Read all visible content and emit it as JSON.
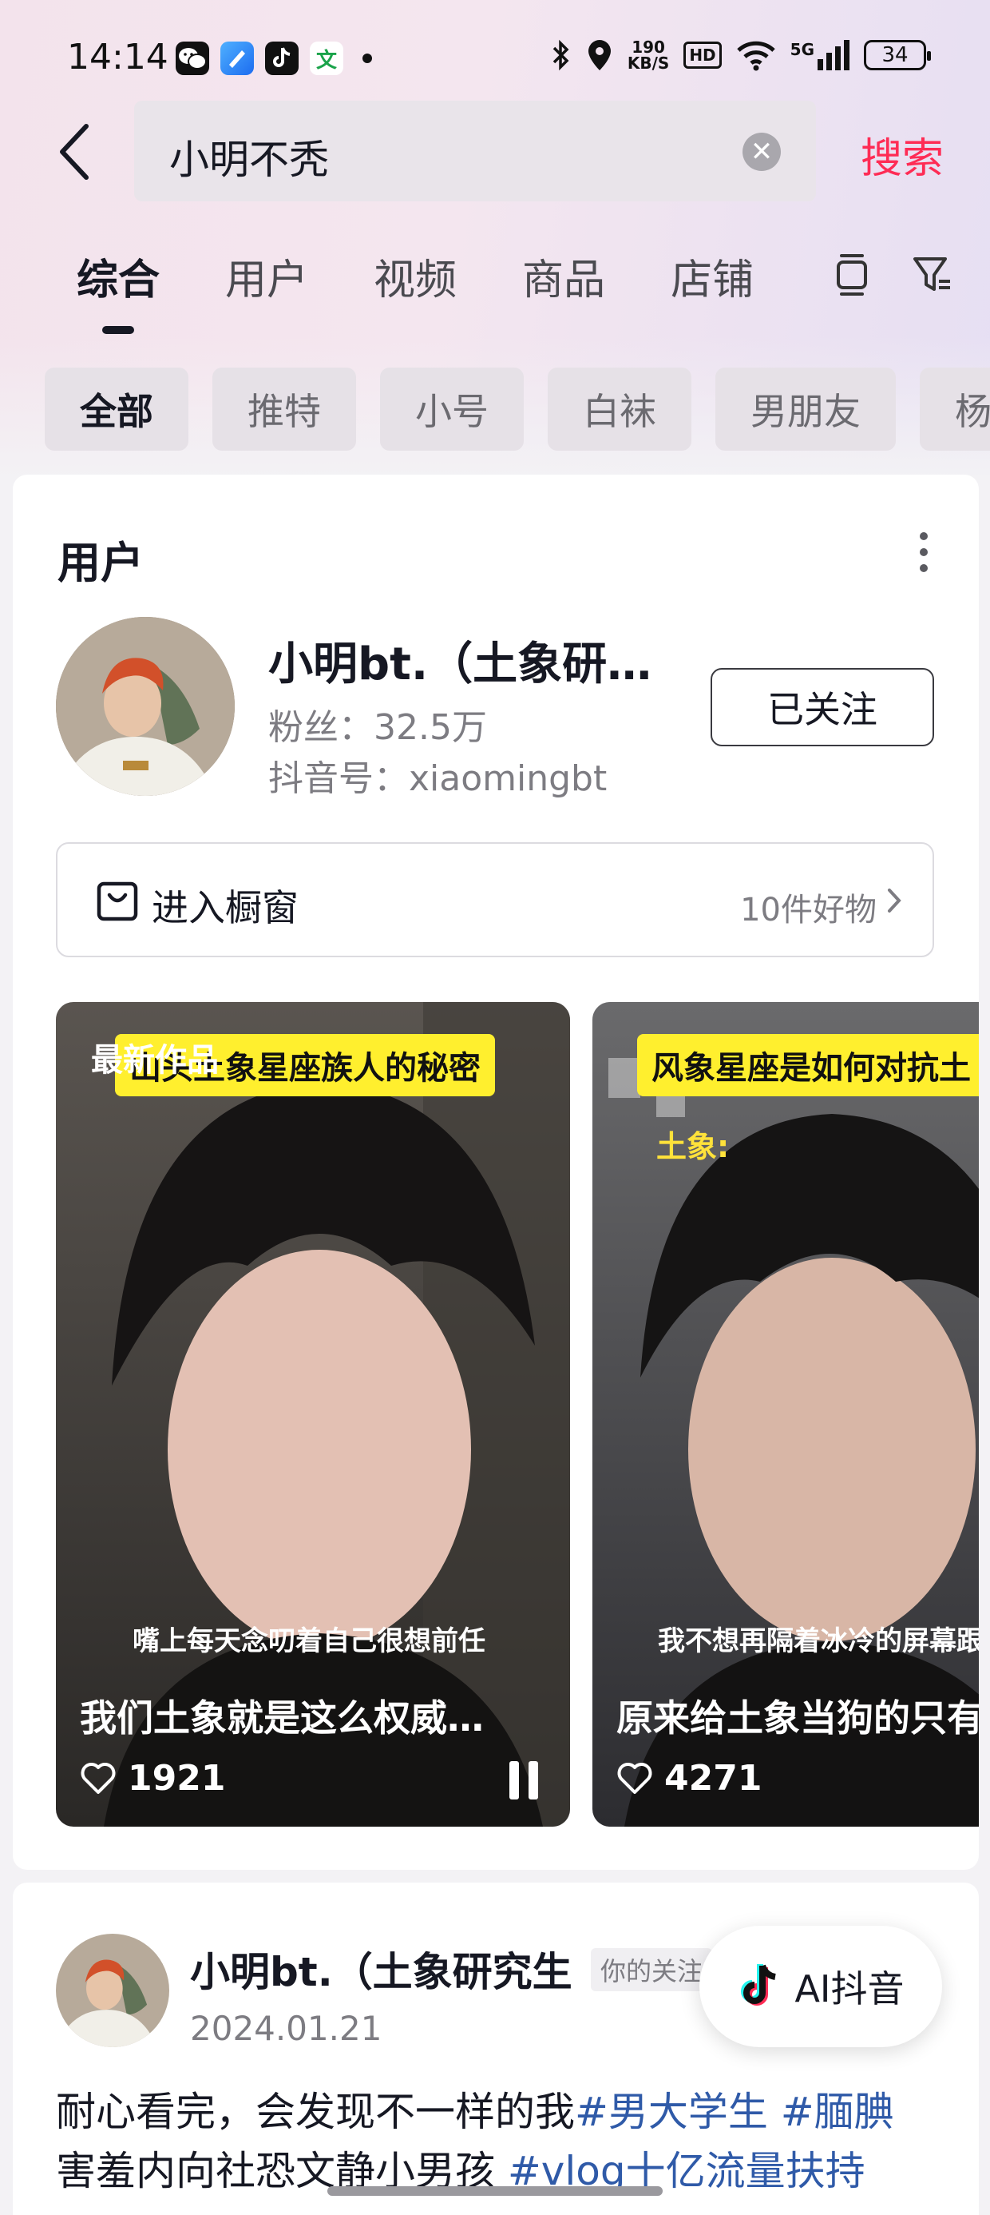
{
  "status_bar": {
    "time": "14:14",
    "network_speed_top": "190",
    "network_speed_bottom": "KB/S",
    "hd": "HD",
    "signal": "5G",
    "battery": "34",
    "app_icons": [
      "wechat-icon",
      "app-blue-icon",
      "douyin-icon",
      "wenku-icon"
    ]
  },
  "search": {
    "query": "小明不秃",
    "button_label": "搜索"
  },
  "tabs": [
    "综合",
    "用户",
    "视频",
    "商品",
    "店铺"
  ],
  "chips": [
    "全部",
    "推特",
    "小号",
    "白袜",
    "男朋友",
    "杨"
  ],
  "user_card": {
    "section_title": "用户",
    "name": "小明bt.（土象研…",
    "fans": "粉丝：32.5万",
    "douyin_id": "抖音号：xiaomingbt",
    "follow_label": "已关注",
    "shop_label": "进入橱窗",
    "shop_count": "10件好物",
    "videos": [
      {
        "badge": "最新作品",
        "banner": "山头土象星座族人的秘密",
        "subtitle": "嘴上每天念叨着自己很想前任",
        "caption": "我们土象就是这么权威…",
        "likes": "1921"
      },
      {
        "banner": "风象星座是如何对抗土",
        "overlay": "土象:",
        "subtitle": "我不想再隔着冰冷的屏幕跟你讲",
        "caption": "原来给土象当狗的只有",
        "likes": "4271"
      }
    ]
  },
  "post": {
    "name": "小明bt.（土象研究生",
    "tag": "你的关注",
    "date": "2024.01.21",
    "line1_text": "耐心看完，会发现不一样的我",
    "line1_tags": "#男大学生 #腼腆",
    "line2_text": "害羞内向社恐文静小男孩 ",
    "line2_tags": "#vlog十亿流量扶持"
  },
  "ai_button": "AI抖音",
  "colors": {
    "accent": "#fe2c55",
    "hashtag": "#2f5aa8",
    "banner_yellow": "#ffef2e"
  }
}
